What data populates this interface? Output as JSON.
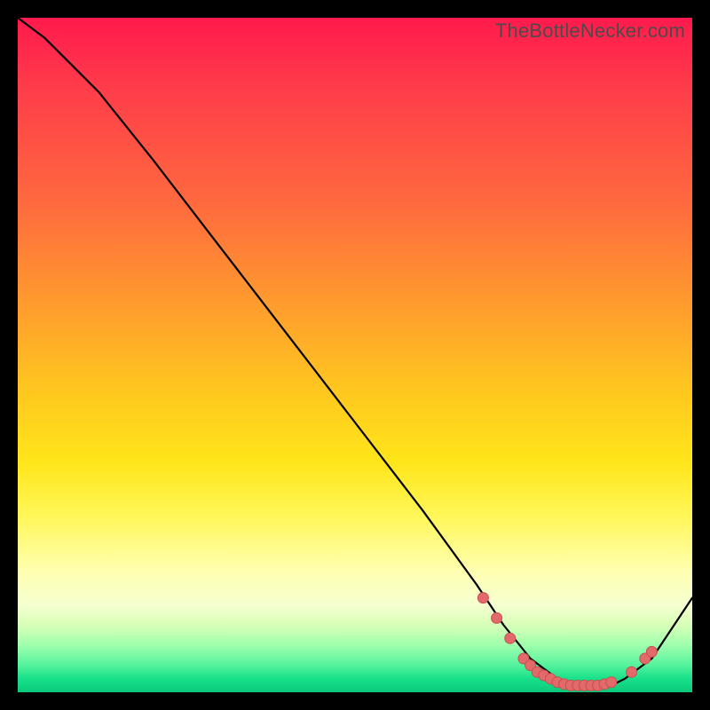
{
  "watermark": "TheBottleNecker.com",
  "colors": {
    "curve": "#000000",
    "marker": "#e26a6a",
    "marker_stroke": "#c94f4f"
  },
  "chart_data": {
    "type": "line",
    "title": "",
    "xlabel": "",
    "ylabel": "",
    "xlim": [
      0,
      100
    ],
    "ylim": [
      0,
      100
    ],
    "series": [
      {
        "name": "curve",
        "x": [
          0,
          4,
          8,
          12,
          20,
          30,
          40,
          50,
          60,
          68,
          72,
          76,
          80,
          84,
          88,
          90,
          94,
          100
        ],
        "y": [
          100,
          97,
          93,
          89,
          79,
          66,
          53,
          40,
          27,
          16,
          10,
          5,
          2,
          1,
          1,
          2,
          5,
          14
        ]
      }
    ],
    "markers": [
      {
        "x": 69,
        "y": 14
      },
      {
        "x": 71,
        "y": 11
      },
      {
        "x": 73,
        "y": 8
      },
      {
        "x": 75,
        "y": 5
      },
      {
        "x": 76,
        "y": 4
      },
      {
        "x": 77,
        "y": 3
      },
      {
        "x": 78,
        "y": 2.5
      },
      {
        "x": 79,
        "y": 2
      },
      {
        "x": 80,
        "y": 1.5
      },
      {
        "x": 81,
        "y": 1.2
      },
      {
        "x": 82,
        "y": 1
      },
      {
        "x": 83,
        "y": 1
      },
      {
        "x": 84,
        "y": 1
      },
      {
        "x": 85,
        "y": 1
      },
      {
        "x": 86,
        "y": 1
      },
      {
        "x": 87,
        "y": 1.2
      },
      {
        "x": 88,
        "y": 1.5
      },
      {
        "x": 91,
        "y": 3
      },
      {
        "x": 93,
        "y": 5
      },
      {
        "x": 94,
        "y": 6
      }
    ]
  }
}
